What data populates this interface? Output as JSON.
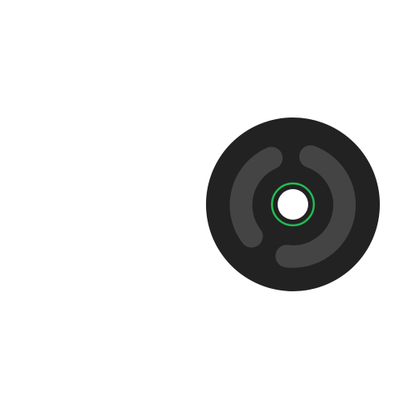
{
  "widget": {
    "icon": "vinyl-record-icon",
    "colors": {
      "disc": "#222222",
      "groove": "#444444",
      "ring": "#22bb55",
      "hole": "#ffffff",
      "background": "#ffffff"
    }
  }
}
